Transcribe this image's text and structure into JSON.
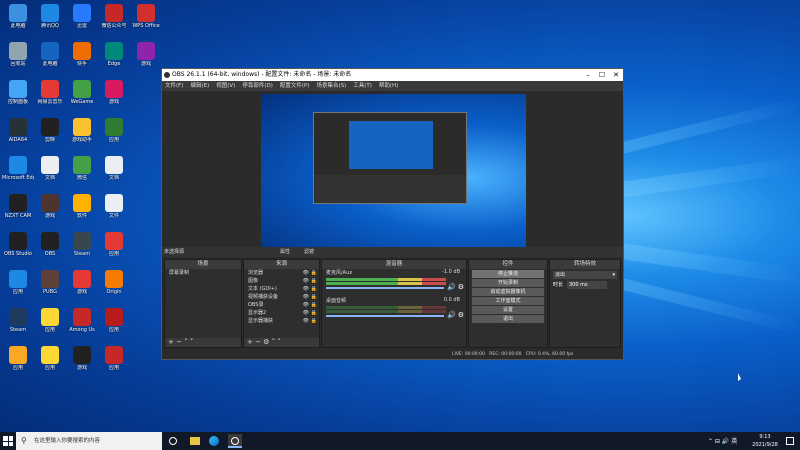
{
  "desktop": {
    "icons": [
      {
        "label": "此电脑",
        "color": "#3d8fe0"
      },
      {
        "label": "腾讯QQ",
        "color": "#1e88e5"
      },
      {
        "label": "迅雷",
        "color": "#2979ff"
      },
      {
        "label": "微信公众号",
        "color": "#c62828"
      },
      {
        "label": "WPS Office",
        "color": "#d32f2f"
      },
      {
        "label": "回收站",
        "color": "#90a4ae"
      },
      {
        "label": "此电脑",
        "color": "#1565c0"
      },
      {
        "label": "快手",
        "color": "#ef6c00"
      },
      {
        "label": "Edge",
        "color": "#00897b"
      },
      {
        "label": "游戏",
        "color": "#8e24aa"
      },
      {
        "label": "控制面板",
        "color": "#42a5f5"
      },
      {
        "label": "网易云音乐",
        "color": "#e53935"
      },
      {
        "label": "WeGame",
        "color": "#43a047"
      },
      {
        "label": "游戏",
        "color": "#d81b60"
      },
      {
        "label": "AIDA64",
        "color": "#263238"
      },
      {
        "label": "剪映",
        "color": "#212121"
      },
      {
        "label": "游戏助手",
        "color": "#fbc02d"
      },
      {
        "label": "应用",
        "color": "#2e7d32"
      },
      {
        "label": "Microsoft Edge",
        "color": "#1e88e5"
      },
      {
        "label": "文档",
        "color": "#eceff1"
      },
      {
        "label": "微信",
        "color": "#43a047"
      },
      {
        "label": "文档",
        "color": "#eceff1"
      },
      {
        "label": "NZXT CAM",
        "color": "#212121"
      },
      {
        "label": "游戏",
        "color": "#4e342e"
      },
      {
        "label": "软件",
        "color": "#ffb300"
      },
      {
        "label": "文件",
        "color": "#eceff1"
      },
      {
        "label": "OBS Studio",
        "color": "#212121"
      },
      {
        "label": "OBS",
        "color": "#212121"
      },
      {
        "label": "Steam",
        "color": "#37474f"
      },
      {
        "label": "应用",
        "color": "#e53935"
      },
      {
        "label": "应用",
        "color": "#1e88e5"
      },
      {
        "label": "PUBG",
        "color": "#5d4037"
      },
      {
        "label": "游戏",
        "color": "#e53935"
      },
      {
        "label": "Origin",
        "color": "#f57c00"
      },
      {
        "label": "Steam",
        "color": "#1e3a5f"
      },
      {
        "label": "应用",
        "color": "#fdd835"
      },
      {
        "label": "Among Us",
        "color": "#c62828"
      },
      {
        "label": "应用",
        "color": "#b71c1c"
      },
      {
        "label": "应用",
        "color": "#f9a825"
      },
      {
        "label": "应用",
        "color": "#fdd835"
      },
      {
        "label": "游戏",
        "color": "#212121"
      },
      {
        "label": "应用",
        "color": "#c62828"
      }
    ]
  },
  "obs": {
    "title": "OBS 26.1.1 (64-bit, windows) - 配置文件: 未命名 - 场景: 未命名",
    "menu": [
      "文件(F)",
      "编辑(E)",
      "视图(V)",
      "停靠部件(D)",
      "配置文件(P)",
      "场景集合(S)",
      "工具(T)",
      "帮助(H)"
    ],
    "source_bar": {
      "label": "未选择源",
      "props": "属性",
      "filters": "滤镜"
    },
    "scenes": {
      "header": "场景",
      "items": [
        "屏幕录制"
      ]
    },
    "sources": {
      "header": "来源",
      "items": [
        "浏览器",
        "图像",
        "文本 (GDI+)",
        "视频捕获设备",
        "OBS录",
        "显示器2",
        "显示器捕获"
      ]
    },
    "mixer": {
      "header": "混音器",
      "channels": [
        {
          "name": "麦克风/Aux",
          "db": "-1.0 dB"
        },
        {
          "name": "桌面音频",
          "db": "0.0 dB"
        }
      ]
    },
    "controls": {
      "header": "控件",
      "buttons": [
        "停止推流",
        "开始录制",
        "启动虚拟摄像机",
        "工作室模式",
        "设置",
        "退出"
      ]
    },
    "transitions": {
      "header": "转场特效",
      "type": "淡出",
      "duration_label": "时长",
      "duration": "300 ms"
    },
    "status": {
      "live": "LIVE: 00:00:00",
      "rec": "REC: 00:00:00",
      "cpu": "CPU: 0.4%, 60.00 fps"
    }
  },
  "taskbar": {
    "search_placeholder": "在这里输入你要搜索的内容",
    "time": "9:13",
    "date": "2021/9/28"
  }
}
